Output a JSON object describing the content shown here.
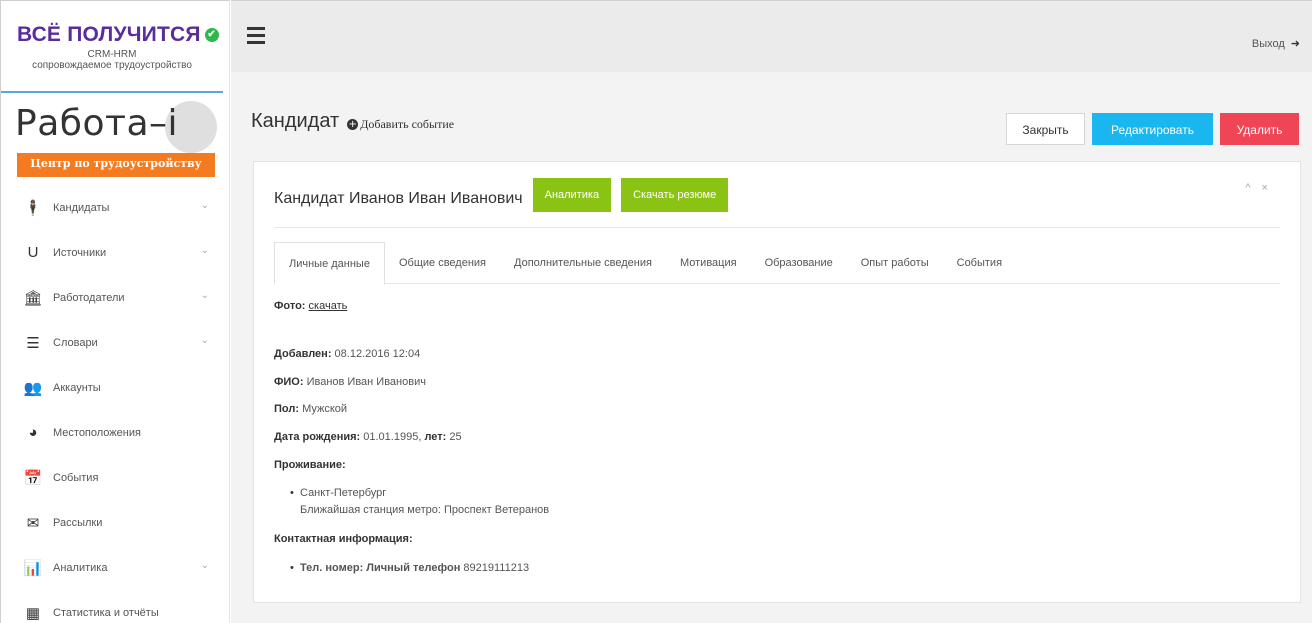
{
  "brand": {
    "title": "ВСЁ ПОЛУЧИТСЯ",
    "subtitle1": "CRM-HRM",
    "subtitle2": "сопровождаемое трудоустройство"
  },
  "logo": {
    "text": "Работа–i",
    "banner": "Центр по трудоустройству"
  },
  "sidebar": {
    "items": [
      {
        "label": "Кандидаты",
        "icon": "person-icon",
        "glyph": "🕴",
        "chevron": true
      },
      {
        "label": "Источники",
        "icon": "magnet-icon",
        "glyph": "U",
        "chevron": true
      },
      {
        "label": "Работодатели",
        "icon": "bank-icon",
        "glyph": "🏛",
        "chevron": true
      },
      {
        "label": "Словари",
        "icon": "list-icon",
        "glyph": "☰",
        "chevron": true
      },
      {
        "label": "Аккаунты",
        "icon": "users-icon",
        "glyph": "👥",
        "chevron": false
      },
      {
        "label": "Местоположения",
        "icon": "globe-icon",
        "glyph": "◕",
        "chevron": false
      },
      {
        "label": "События",
        "icon": "calendar-icon",
        "glyph": "📅",
        "chevron": false
      },
      {
        "label": "Рассылки",
        "icon": "envelope-icon",
        "glyph": "✉",
        "chevron": false
      },
      {
        "label": "Аналитика",
        "icon": "bar-chart-icon",
        "glyph": "📊",
        "chevron": true
      },
      {
        "label": "Статистика и отчёты",
        "icon": "table-icon",
        "glyph": "▦",
        "chevron": false
      }
    ],
    "chevron_glyph": "⌄"
  },
  "topbar": {
    "logout_label": "Выход",
    "logout_glyph": "➜"
  },
  "page": {
    "title": "Кандидат",
    "add_event_label": "Добавить событие"
  },
  "actions": {
    "close_label": "Закрыть",
    "edit_label": "Редактировать",
    "delete_label": "Удалить"
  },
  "card": {
    "candidate_title": "Кандидат Иванов Иван Иванович",
    "analytics_label": "Аналитика",
    "download_label": "Скачать резюме",
    "tools": "^ ×"
  },
  "tabs": [
    {
      "label": "Личные данные",
      "active": true
    },
    {
      "label": "Общие сведения",
      "active": false
    },
    {
      "label": "Дополнительные сведения",
      "active": false
    },
    {
      "label": "Мотивация",
      "active": false
    },
    {
      "label": "Образование",
      "active": false
    },
    {
      "label": "Опыт работы",
      "active": false
    },
    {
      "label": "События",
      "active": false
    }
  ],
  "details": {
    "photo_label": "Фото:",
    "photo_link": "скачать",
    "added_label": "Добавлен:",
    "added_value": " 08.12.2016 12:04",
    "fio_label": "ФИО:",
    "fio_value": " Иванов Иван Иванович",
    "gender_label": "Пол:",
    "gender_value": " Мужской",
    "birth_label": "Дата рождения:",
    "birth_value": " 01.01.1995, ",
    "age_label": "лет:",
    "age_value": " 25",
    "residence_label": "Проживание:",
    "city": "Санкт-Петербург",
    "metro": "Ближайшая станция метро: Проспект Ветеранов",
    "contacts_label": "Контактная информация:",
    "phone_label": "Тел. номер: Личный телефон",
    "phone_value": " 89219111213"
  }
}
